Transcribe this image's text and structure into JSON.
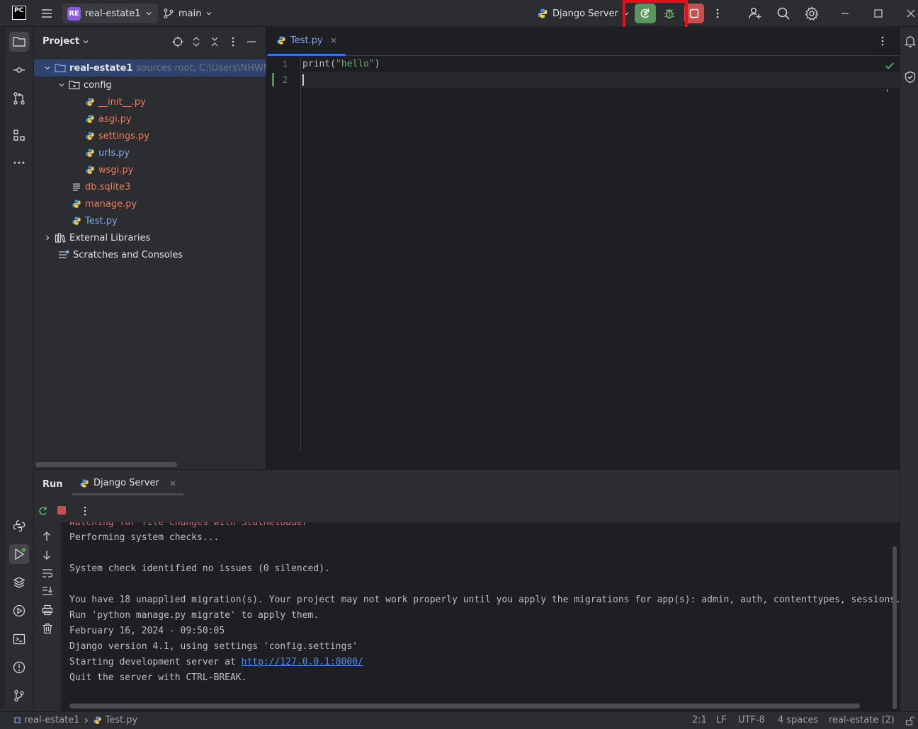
{
  "app": {
    "logo": "PC"
  },
  "titlebar": {
    "project_badge": "RE",
    "project_name": "real-estate1",
    "branch": "main",
    "run_config": "Django Server"
  },
  "project_panel": {
    "title": "Project",
    "tree": [
      {
        "label": "real-estate1",
        "hint": "sources root,  C:\\Users\\NHWM",
        "level": 0,
        "type": "root-folder"
      },
      {
        "label": "config",
        "level": 1,
        "type": "folder"
      },
      {
        "label": "__init__.py",
        "level": 2,
        "type": "py"
      },
      {
        "label": "asgi.py",
        "level": 2,
        "type": "py"
      },
      {
        "label": "settings.py",
        "level": 2,
        "type": "py"
      },
      {
        "label": "urls.py",
        "level": 2,
        "type": "py-blue"
      },
      {
        "label": "wsgi.py",
        "level": 2,
        "type": "py"
      },
      {
        "label": "db.sqlite3",
        "level": 1,
        "type": "db"
      },
      {
        "label": "manage.py",
        "level": 1,
        "type": "py"
      },
      {
        "label": "Test.py",
        "level": 1,
        "type": "py-blue"
      },
      {
        "label": "External Libraries",
        "level": 0,
        "type": "libs"
      },
      {
        "label": "Scratches and Consoles",
        "level": 0,
        "type": "scratch"
      }
    ]
  },
  "editor": {
    "tab_label": "Test.py",
    "line_numbers": [
      "1",
      "2"
    ],
    "code": {
      "fn": "print(",
      "str": "\"hello\"",
      "close": ")"
    }
  },
  "run_panel": {
    "title": "Run",
    "tab_label": "Django Server",
    "console_lines": [
      "Watching for file changes with StatReloader",
      "Performing system checks...",
      "",
      "System check identified no issues (0 silenced).",
      "",
      "You have 18 unapplied migration(s). Your project may not work properly until you apply the migrations for app(s): admin, auth, contenttypes, sessions.",
      "Run 'python manage.py migrate' to apply them.",
      "February 16, 2024 - 09:50:05",
      "Django version 4.1, using settings 'config.settings'",
      "Starting development server at ",
      "Quit the server with CTRL-BREAK."
    ],
    "server_url": "http://127.0.0.1:8000/"
  },
  "statusbar": {
    "breadcrumb_project": "real-estate1",
    "breadcrumb_file": "Test.py",
    "position": "2:1",
    "line_ending": "LF",
    "encoding": "UTF-8",
    "indent": "4 spaces",
    "interpreter": "real-estate (2)"
  },
  "colors": {
    "accent": "#3574f0",
    "run_green": "#57965c",
    "stop_red": "#c94f4f",
    "highlight": "#e3101a",
    "python_file": "#f07a5c"
  }
}
